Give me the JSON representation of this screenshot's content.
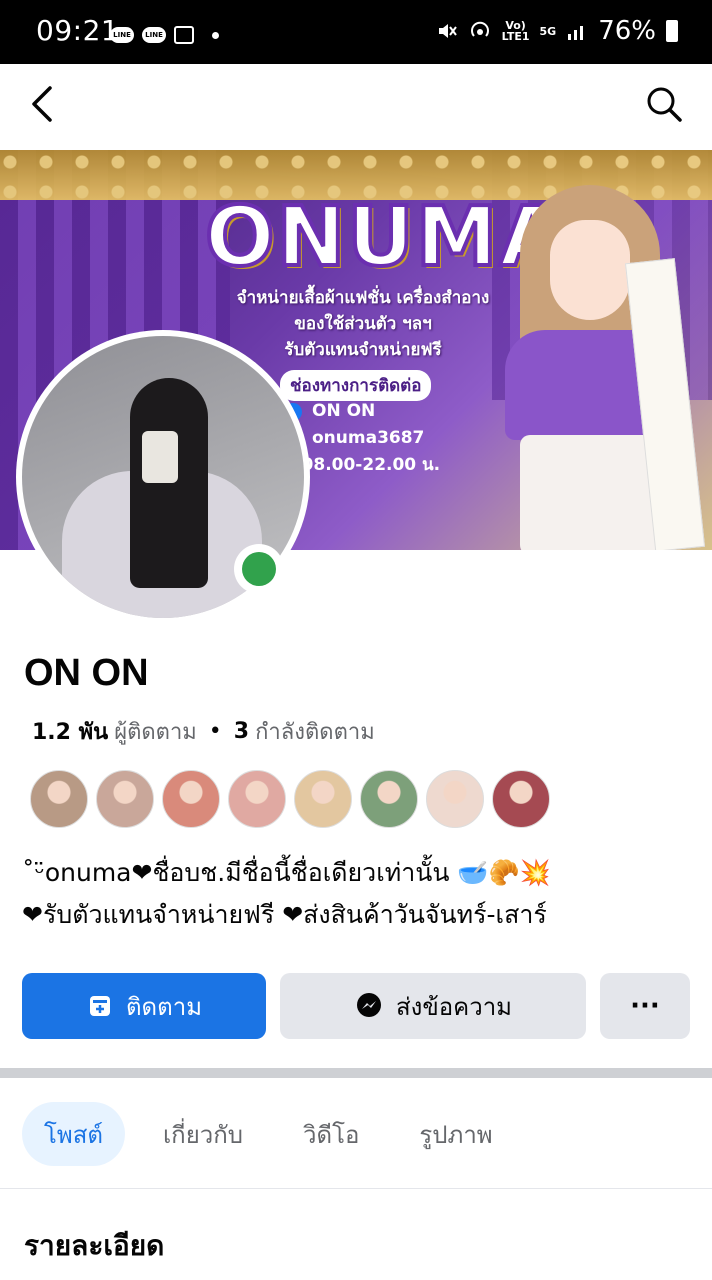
{
  "status_bar": {
    "time": "09:21",
    "left_icons": [
      "line-icon",
      "line-icon",
      "gallery-icon",
      "dot-icon"
    ],
    "volte": "Vo)\nLTE1",
    "network": "5G",
    "battery": "76%"
  },
  "nav": {
    "back_icon": "back-arrow-icon",
    "search_icon": "search-icon"
  },
  "cover": {
    "title": "ONUMA",
    "lines": [
      "จำหน่ายเสื้อผ้าแฟชั่น เครื่องสำอาง",
      "ของใช้ส่วนตัว ฯลฯ",
      "รับตัวแทนจำหน่ายฟรี"
    ],
    "channel_label": "ช่องทางการติดต่อ",
    "contacts": [
      "ON ON",
      "onuma3687",
      "น 08.00-22.00 น."
    ]
  },
  "profile": {
    "name": "ON ON",
    "followers_count": "1.2 พัน",
    "followers_label": "ผู้ติดตาม",
    "separator": "•",
    "following_count": "3",
    "following_label": "กำลังติดตาม",
    "bio_line1": "˚ᵕ̈onuma❤ชื่อบช.มีชื่อนี้ชื่อเดียวเท่านั้น 🥣🥐💥",
    "bio_line2": "❤รับตัวแทนจำหน่ายฟรี ❤ส่งสินค้าวันจันทร์-เสาร์"
  },
  "friends": {
    "colors": [
      "#b89a85",
      "#c9a79a",
      "#d98a7b",
      "#e0a9a2",
      "#e3c7a0",
      "#7da07a",
      "#eed9cf",
      "#a54a52"
    ]
  },
  "actions": {
    "follow_label": "ติดตาม",
    "message_label": "ส่งข้อความ",
    "more_label": "···"
  },
  "tabs": [
    {
      "label": "โพสต์",
      "active": true
    },
    {
      "label": "เกี่ยวกับ",
      "active": false
    },
    {
      "label": "วิดีโอ",
      "active": false
    },
    {
      "label": "รูปภาพ",
      "active": false
    }
  ],
  "details": {
    "title": "รายละเอียด"
  },
  "colors": {
    "primary": "#1b74e4",
    "online": "#31a24c",
    "secondary_button": "#e4e6eb"
  }
}
